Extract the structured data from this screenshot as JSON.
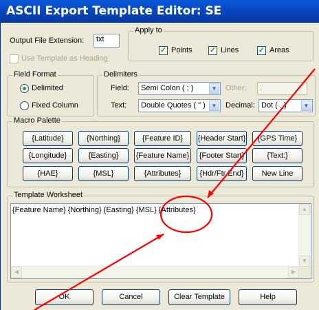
{
  "window": {
    "title": "ASCII Export Template Editor: SE"
  },
  "output_extension": {
    "label": "Output File Extension:",
    "value": "txt"
  },
  "use_template_heading": {
    "label": "Use Template as Heading",
    "checked": false
  },
  "apply_to": {
    "legend": "Apply to",
    "points": {
      "label": "Points",
      "checked": true
    },
    "lines": {
      "label": "Lines",
      "checked": true
    },
    "areas": {
      "label": "Areas",
      "checked": true
    }
  },
  "field_format": {
    "legend": "Field Format",
    "delimited": "Delimited",
    "fixed_column": "Fixed Column",
    "selected": "Delimited"
  },
  "delimiters": {
    "legend": "Delimiters",
    "field_label": "Field:",
    "field_value": "Semi Colon ( ; )",
    "text_label": "Text:",
    "text_value": "Double Quotes ( \" )",
    "other_label": "Other:",
    "other_value": ";",
    "decimal_label": "Decimal:",
    "decimal_value": "Dot ( . )"
  },
  "macro_palette": {
    "legend": "Macro Palette",
    "rows": [
      [
        "{Latitude}",
        "{Northing}",
        "{Feature ID}",
        "{Header Start}",
        "{GPS Time}"
      ],
      [
        "{Longitude}",
        "{Easting}",
        "{Feature Name}",
        "{Footer Start}",
        "{Text:}"
      ],
      [
        "{HAE}",
        "{MSL}",
        "{Attributes}",
        "{Hdr/Ftr End}",
        "New Line"
      ]
    ]
  },
  "worksheet": {
    "legend": "Template Worksheet",
    "text": "{Feature Name} {Northing} {Easting} {MSL} {Attributes}"
  },
  "buttons": {
    "ok": "OK",
    "cancel": "Cancel",
    "clear": "Clear Template",
    "help": "Help"
  },
  "colors": {
    "title_bar": "#0843B8",
    "dialog_bg": "#ECE9D8",
    "annotation": "#FF0000"
  }
}
